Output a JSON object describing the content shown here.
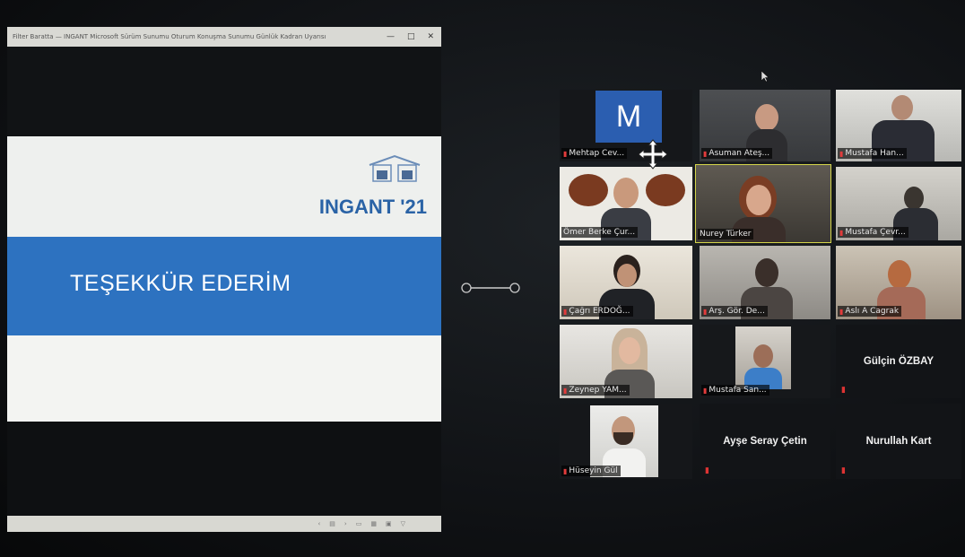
{
  "presentation": {
    "window_title": "Filter Baratta — INGANT Microsoft Sürüm Sunumu Oturum Konuşma Sunumu Günlük Kadran Uyarısı",
    "brand": "INGANT '21",
    "heading": "TEŞEKKÜR EDERİM",
    "accent_color": "#2d72c0"
  },
  "participants": [
    {
      "name": "Mehtap Cev...",
      "avatar_letter": "M"
    },
    {
      "name": "Asuman Ateş..."
    },
    {
      "name": "Mustafa Han..."
    },
    {
      "name": "Ömer Berke Çur..."
    },
    {
      "name": "Nurey Türker",
      "active_speaker": true
    },
    {
      "name": "Mustafa Çevr..."
    },
    {
      "name": "Çağrı ERDOĞ..."
    },
    {
      "name": "Arş. Gör. De..."
    },
    {
      "name": "Aslı A Cagrak"
    },
    {
      "name": "Zeynep YAM..."
    },
    {
      "name": "Mustafa San..."
    },
    {
      "name": "Gülçin ÖZBAY"
    },
    {
      "name": "Hüseyin Gül"
    },
    {
      "name": "Ayşe Seray Çetin"
    },
    {
      "name": "Nurullah Kart"
    }
  ],
  "icons": [
    "move-icon",
    "cursor-icon",
    "mic-muted-icon",
    "split-handle-icon"
  ]
}
